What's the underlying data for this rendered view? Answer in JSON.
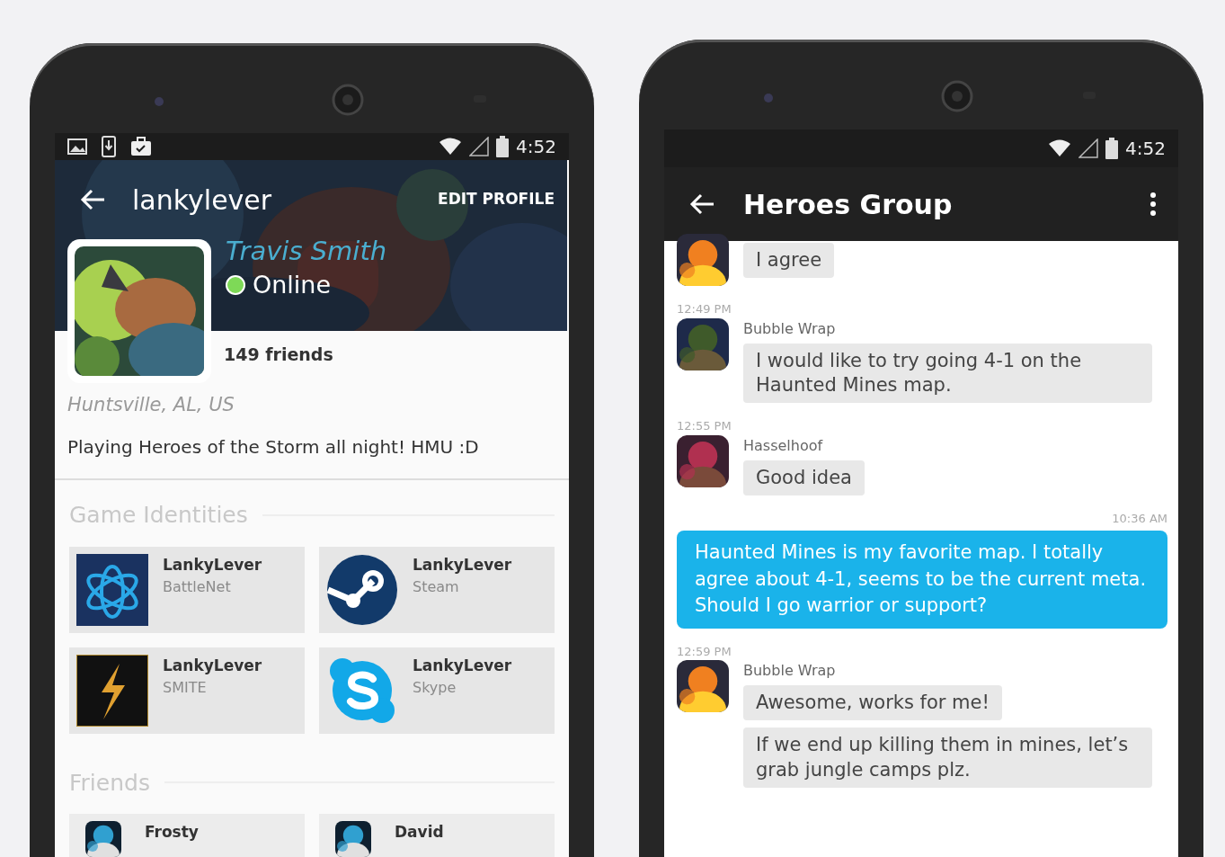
{
  "profile_screen": {
    "status_bar": {
      "time": "4:52"
    },
    "app_bar": {
      "username": "lankylever",
      "action": "EDIT PROFILE"
    },
    "profile": {
      "name": "Travis Smith",
      "status": "Online",
      "online": true,
      "friends": "149 friends",
      "location": "Huntsville, AL, US",
      "bio": "Playing Heroes of the Storm all night! HMU :D"
    },
    "sections": [
      {
        "title": "Game Identities",
        "items": [
          {
            "kind": "battlenet",
            "name": "LankyLever",
            "service": "BattleNet"
          },
          {
            "kind": "steam",
            "name": "LankyLever",
            "service": "Steam"
          },
          {
            "kind": "smite",
            "name": "LankyLever",
            "service": "SMITE"
          },
          {
            "kind": "skype",
            "name": "LankyLever",
            "service": "Skype"
          }
        ]
      },
      {
        "title": "Friends",
        "items": [
          {
            "kind": "friend",
            "name": "Frosty"
          },
          {
            "kind": "friend",
            "name": "David"
          }
        ]
      }
    ]
  },
  "chat_screen": {
    "status_bar": {
      "time": "4:52"
    },
    "app_bar": {
      "title": "Heroes Group"
    },
    "messages": [
      {
        "kind": "incoming",
        "texts": [
          "I agree"
        ]
      },
      {
        "kind": "incoming",
        "time": "12:49 PM",
        "sender": "Bubble Wrap",
        "texts": [
          "I would like to try going 4-1 on the Haunted Mines map."
        ]
      },
      {
        "kind": "incoming",
        "time": "12:55 PM",
        "sender": "Hasselhoof",
        "texts": [
          "Good idea"
        ]
      },
      {
        "kind": "outgoing",
        "time": "10:36 AM",
        "texts": [
          "Haunted Mines is my favorite map. I totally agree about 4-1, seems to be the current meta. Should I go warrior or support?"
        ]
      },
      {
        "kind": "incoming",
        "time": "12:59 PM",
        "sender": "Bubble Wrap",
        "texts": [
          "Awesome, works for me!",
          "If we end up killing them in mines, let’s grab jungle camps plz."
        ]
      }
    ]
  }
}
